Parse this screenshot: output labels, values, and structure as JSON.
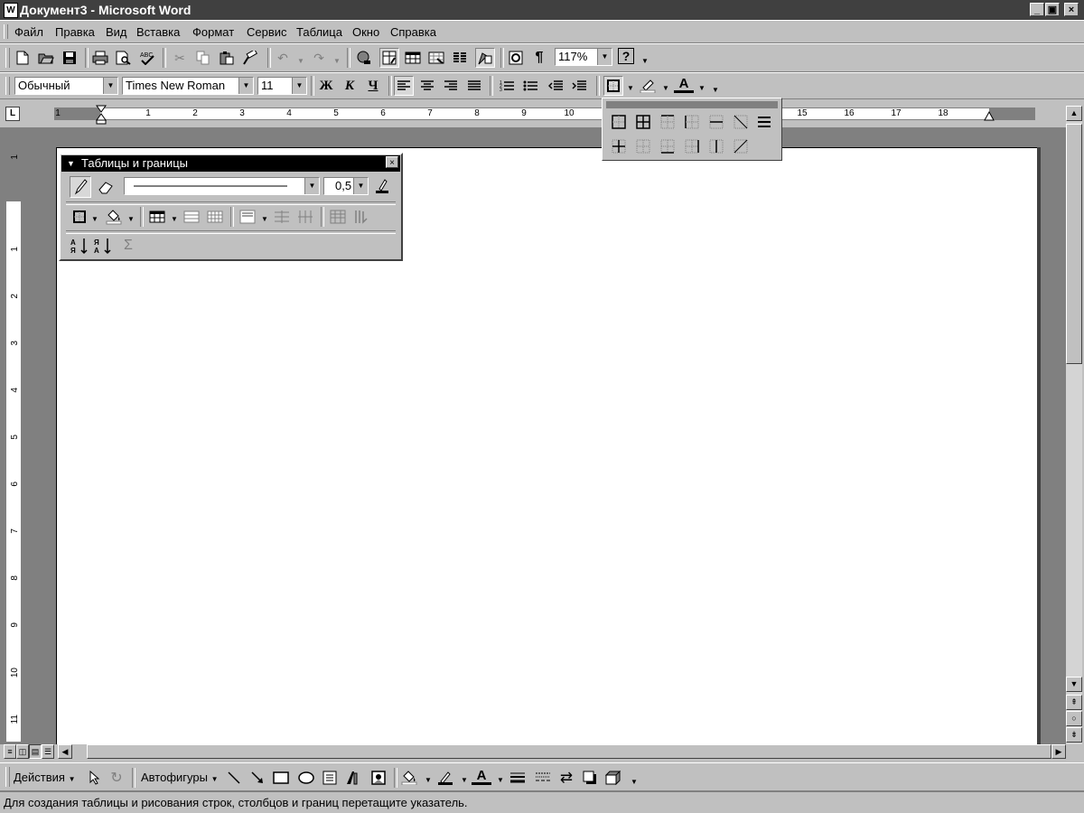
{
  "window": {
    "title": "Документ3 - Microsoft Word",
    "app_icon": "W",
    "controls": {
      "minimize": "_",
      "maximize": "▣",
      "close": "×"
    }
  },
  "menu": {
    "items": [
      {
        "label": "Файл"
      },
      {
        "label": "Правка"
      },
      {
        "label": "Вид"
      },
      {
        "label": "Вставка"
      },
      {
        "label": "Формат"
      },
      {
        "label": "Сервис"
      },
      {
        "label": "Таблица"
      },
      {
        "label": "Окно"
      },
      {
        "label": "Справка"
      }
    ]
  },
  "standard_toolbar": {
    "zoom": "117%",
    "help_icon": "?"
  },
  "formatting_toolbar": {
    "style": "Обычный",
    "font": "Times New Roman",
    "size": "11",
    "bold": "Ж",
    "italic": "К",
    "underline": "Ч",
    "font_color_letter": "A"
  },
  "ruler": {
    "marks": [
      "1",
      "1",
      "2",
      "3",
      "4",
      "5",
      "6",
      "7",
      "8",
      "9",
      "10",
      "15",
      "16",
      "17",
      "18"
    ]
  },
  "vertical_ruler": {
    "marks": [
      "1",
      "1",
      "2",
      "3",
      "4",
      "5",
      "6",
      "7",
      "8",
      "9",
      "10",
      "11"
    ]
  },
  "tables_toolbar": {
    "title": "Таблицы и границы",
    "close": "×",
    "line_weight": "0,5",
    "sum_symbol": "Σ",
    "sort_asc": "АЯ",
    "sort_desc": "ЯА"
  },
  "drawing_toolbar": {
    "actions": "Действия",
    "autoshapes": "Автофигуры",
    "font_color_letter": "A"
  },
  "status_bar": {
    "text": "Для создания таблицы и рисования строк, столбцов и границ перетащите указатель."
  }
}
